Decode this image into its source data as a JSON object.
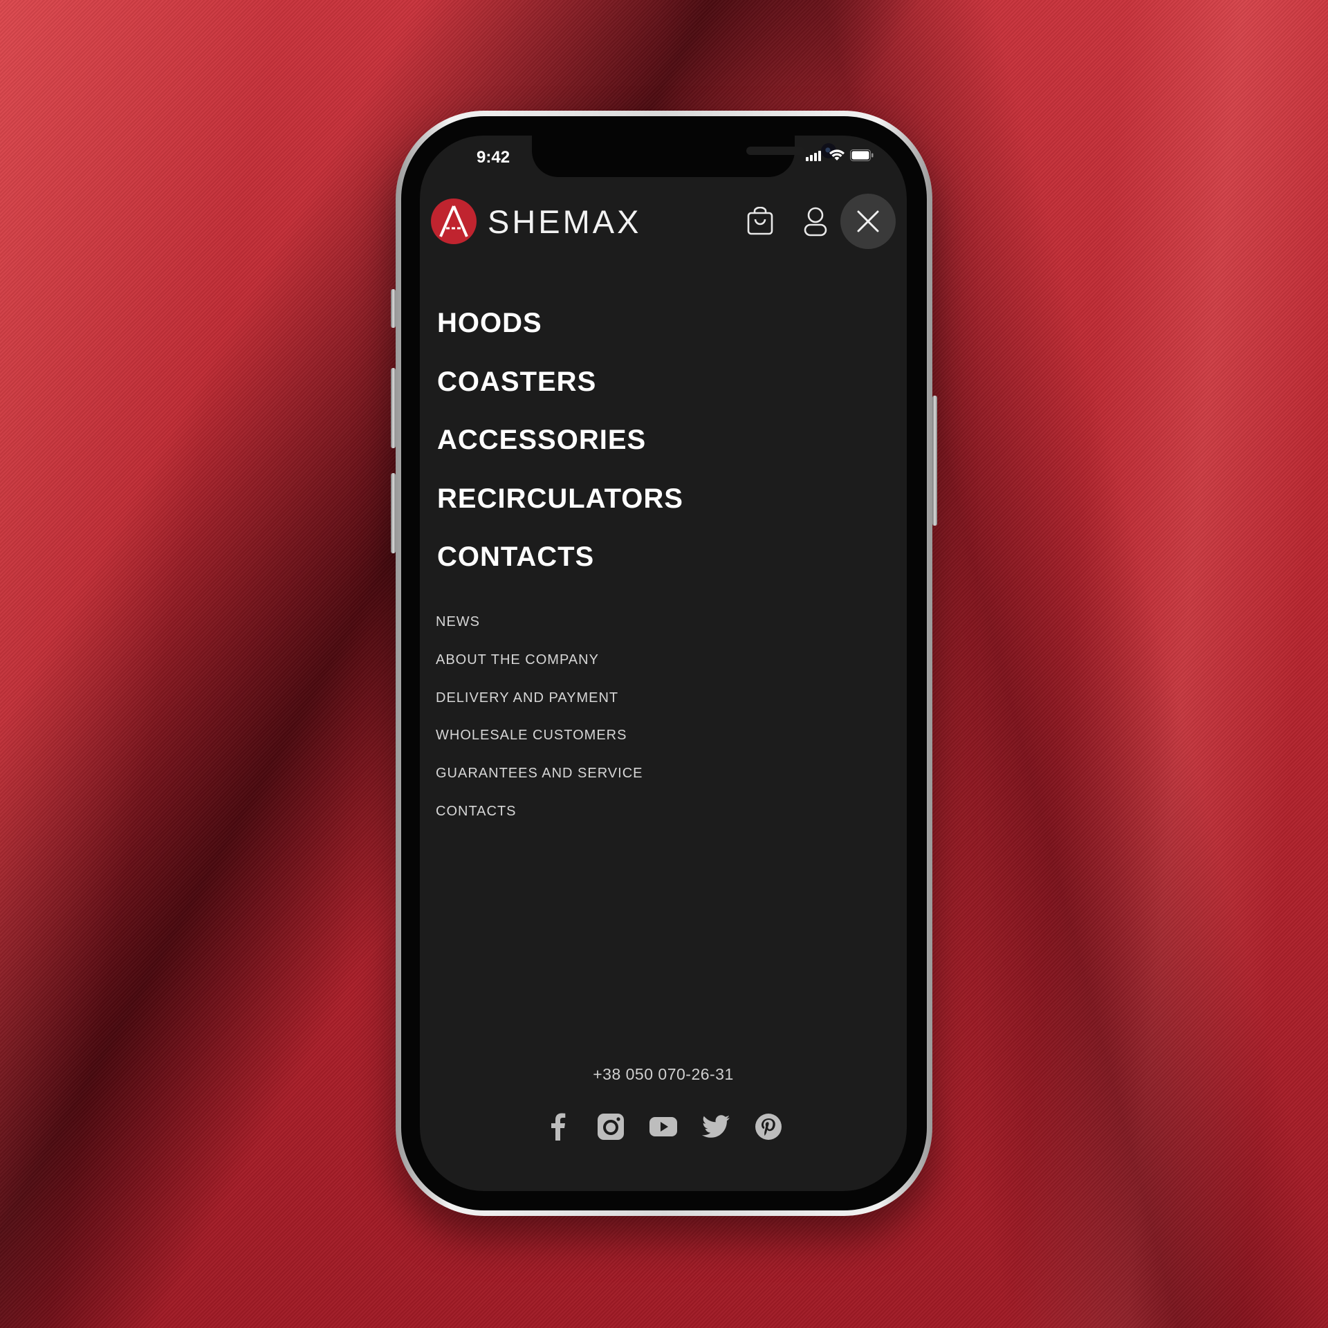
{
  "status_bar": {
    "time": "9:42"
  },
  "header": {
    "brand_name": "SHEMAX",
    "icons": [
      "shopping-bag-icon",
      "user-icon",
      "close-icon"
    ]
  },
  "primary_nav": [
    {
      "label": "HOODS"
    },
    {
      "label": "COASTERS"
    },
    {
      "label": "ACCESSORIES"
    },
    {
      "label": "RECIRCULATORS"
    },
    {
      "label": "CONTACTS"
    }
  ],
  "secondary_nav": [
    {
      "label": "NEWS"
    },
    {
      "label": "ABOUT THE COMPANY"
    },
    {
      "label": "DELIVERY AND PAYMENT"
    },
    {
      "label": "WHOLESALE CUSTOMERS"
    },
    {
      "label": "GUARANTEES AND SERVICE"
    },
    {
      "label": "CONTACTS"
    }
  ],
  "footer": {
    "phone": "+38 050 070-26-31",
    "socials": [
      "facebook-icon",
      "instagram-icon",
      "youtube-icon",
      "twitter-icon",
      "pinterest-icon"
    ]
  },
  "colors": {
    "screen_background": "#1c1c1c",
    "brand_red": "#c0242f",
    "primary_text": "#ffffff",
    "secondary_text": "#d6d6d6",
    "close_button_bg": "#3a3a3a"
  }
}
